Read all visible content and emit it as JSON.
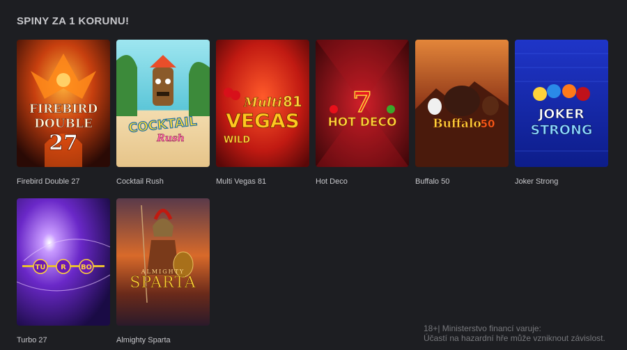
{
  "section": {
    "title": "SPINY ZA 1 KORUNU!"
  },
  "games": [
    {
      "name": "Firebird Double 27",
      "art_text": [
        "FIREBIRD",
        "DOUBLE",
        "27"
      ],
      "colors": [
        "#2a0a05",
        "#e8731c"
      ]
    },
    {
      "name": "Cocktail Rush",
      "art_text": [
        "COCKTAIL",
        "Rush"
      ],
      "colors": [
        "#7fd3e0",
        "#f0d8a8"
      ]
    },
    {
      "name": "Multi Vegas 81",
      "art_text": [
        "Multi",
        "VEGAS",
        "81",
        "WILD"
      ],
      "colors": [
        "#6b0c0c",
        "#e23a1e"
      ]
    },
    {
      "name": "Hot Deco",
      "art_text": [
        "7",
        "HOT DECO"
      ],
      "colors": [
        "#3a0608",
        "#b01620"
      ]
    },
    {
      "name": "Buffalo 50",
      "art_text": [
        "Buffalo",
        "50"
      ],
      "colors": [
        "#3b1208",
        "#c4572a"
      ]
    },
    {
      "name": "Joker Strong",
      "art_text": [
        "JOKER",
        "STRONG"
      ],
      "colors": [
        "#0d1d8a",
        "#2f48d6"
      ]
    },
    {
      "name": "Turbo 27",
      "art_text": [
        "TU",
        "R",
        "BO"
      ],
      "colors": [
        "#1a0b45",
        "#9b3df0"
      ]
    },
    {
      "name": "Almighty Sparta",
      "art_text": [
        "ALMIGHTY",
        "SPARTA"
      ],
      "colors": [
        "#2b1a2a",
        "#d86a2a"
      ]
    }
  ],
  "notice": {
    "line1": "18+| Ministerstvo financí varuje:",
    "line2": "Účastí na hazardní hře může vzniknout závislost."
  }
}
